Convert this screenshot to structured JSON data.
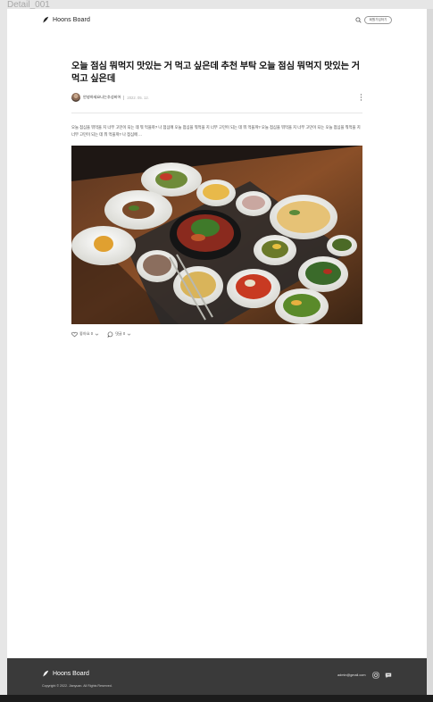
{
  "frame": {
    "label": "Detail_001"
  },
  "header": {
    "logo_text": "Hoons Board",
    "search_icon": "search-icon",
    "login_label": "회원가입하기"
  },
  "article": {
    "title": "오늘 점심 뭐먹지 맛있는 거 먹고 싶은데 추천 부탁 오늘 점심 뭐먹지 맛있는 거 먹고 싶은데",
    "author": "안녕하세요나는추성비어",
    "date": "2022. 05. 12.",
    "body": "오늘 점심을 뭐먹을 지 너무 고민이 되는 데 뭐 먹을까? 나 점심에 오늘 점심을 뭐먹을 지 너무 고민이 되는 데 뭐 먹을까? 오늘 점심을 뭐먹을 지 너무 고민이 되는 오늘 점심을 뭐먹을 지 너무 고민이 되는 데 뭐 먹을까? 나 점심에 ...",
    "image_alt": "korean-table-meal-photo",
    "likes_label": "좋아요 0",
    "comments_label": "댓글 0"
  },
  "footer": {
    "logo_text": "Hoons Board",
    "copyright": "Copyright © 2022. Jianyuan. All Rights Reserved.",
    "email": "admin@gmail.com",
    "icons": [
      "instagram-icon",
      "chat-icon"
    ]
  },
  "colors": {
    "footer_bg": "#3a3a3a",
    "page_bg": "#ffffff",
    "frame_bg": "#e6e6e6"
  }
}
